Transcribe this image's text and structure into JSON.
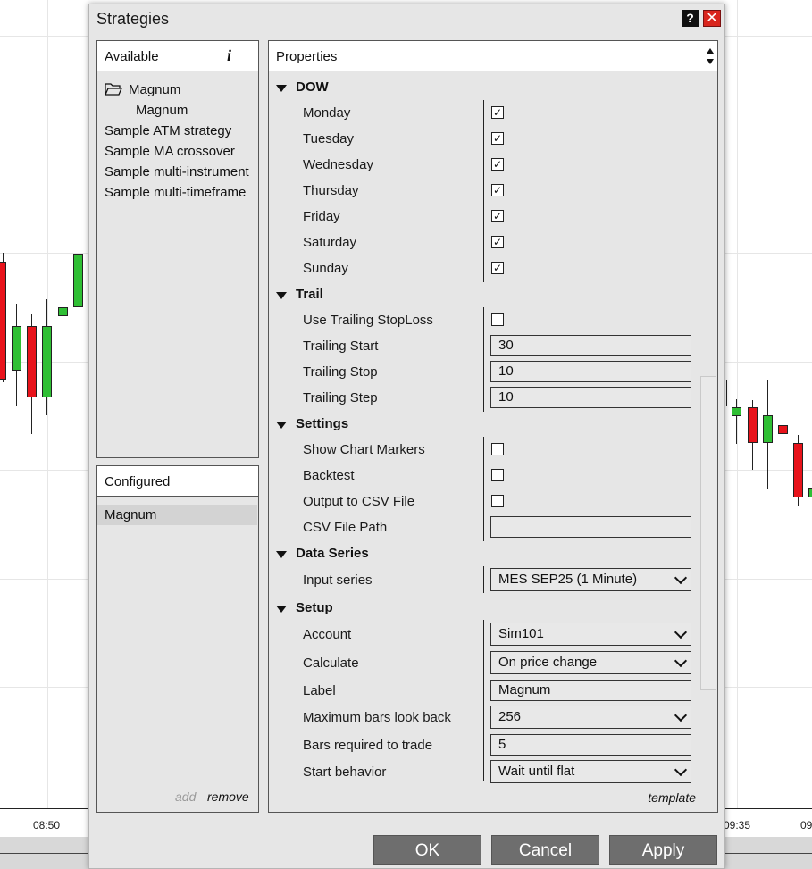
{
  "chart": {
    "time_labels": [
      "08:50",
      "09:35",
      "09"
    ],
    "colors": {
      "up": "#2fbf34",
      "down": "#e8131b",
      "grid": "#e6e6e6"
    }
  },
  "dialog": {
    "title": "Strategies",
    "help_glyph": "?",
    "close_glyph": "✕"
  },
  "available": {
    "header": "Available",
    "info_glyph": "i",
    "folder_icon": "folder-icon",
    "items": [
      "Magnum",
      "Magnum",
      "Sample ATM strategy",
      "Sample MA crossover",
      "Sample multi-instrument",
      "Sample multi-timeframe"
    ]
  },
  "configured": {
    "header": "Configured",
    "selected_item": "Magnum",
    "add_label": "add",
    "remove_label": "remove"
  },
  "properties": {
    "header": "Properties",
    "template_label": "template",
    "groups": {
      "dow": {
        "title": "DOW",
        "rows": [
          {
            "label": "Monday",
            "checked": true
          },
          {
            "label": "Tuesday",
            "checked": true
          },
          {
            "label": "Wednesday",
            "checked": true
          },
          {
            "label": "Thursday",
            "checked": true
          },
          {
            "label": "Friday",
            "checked": true
          },
          {
            "label": "Saturday",
            "checked": true
          },
          {
            "label": "Sunday",
            "checked": true
          }
        ]
      },
      "trail": {
        "title": "Trail",
        "use_trailing_label": "Use Trailing StopLoss",
        "use_trailing_checked": false,
        "trailing_start_label": "Trailing Start",
        "trailing_start_value": "30",
        "trailing_stop_label": "Trailing Stop",
        "trailing_stop_value": "10",
        "trailing_step_label": "Trailing Step",
        "trailing_step_value": "10"
      },
      "settings": {
        "title": "Settings",
        "show_markers_label": "Show Chart Markers",
        "show_markers_checked": false,
        "backtest_label": "Backtest",
        "backtest_checked": false,
        "output_csv_label": "Output to CSV File",
        "output_csv_checked": false,
        "csv_path_label": "CSV File Path",
        "csv_path_value": ""
      },
      "data_series": {
        "title": "Data Series",
        "input_series_label": "Input series",
        "input_series_value": "MES SEP25 (1 Minute)"
      },
      "setup": {
        "title": "Setup",
        "account_label": "Account",
        "account_value": "Sim101",
        "calculate_label": "Calculate",
        "calculate_value": "On price change",
        "label_label": "Label",
        "label_value": "Magnum",
        "max_bars_label": "Maximum bars look back",
        "max_bars_value": "256",
        "bars_required_label": "Bars required to trade",
        "bars_required_value": "5",
        "start_behavior_label": "Start behavior",
        "start_behavior_value": "Wait until flat"
      }
    }
  },
  "buttons": {
    "ok": "OK",
    "cancel": "Cancel",
    "apply": "Apply"
  }
}
